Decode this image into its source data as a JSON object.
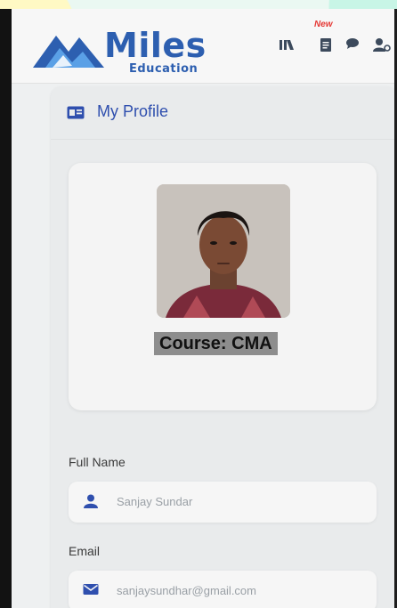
{
  "brand": {
    "name": "Miles",
    "sub": "Education",
    "color": "#2d5fb0"
  },
  "header": {
    "badge_new": "New",
    "icons": [
      "linkedin-icon",
      "document-icon",
      "chat-icon",
      "user-settings-icon"
    ]
  },
  "profile": {
    "title": "My Profile",
    "course": "Course: CMA",
    "full_name_label": "Full Name",
    "full_name_value": "Sanjay Sundar",
    "email_label": "Email",
    "email_value": "sanjaysundhar@gmail.com"
  },
  "colors": {
    "accent": "#2f4fae",
    "new_badge": "#e53935"
  }
}
